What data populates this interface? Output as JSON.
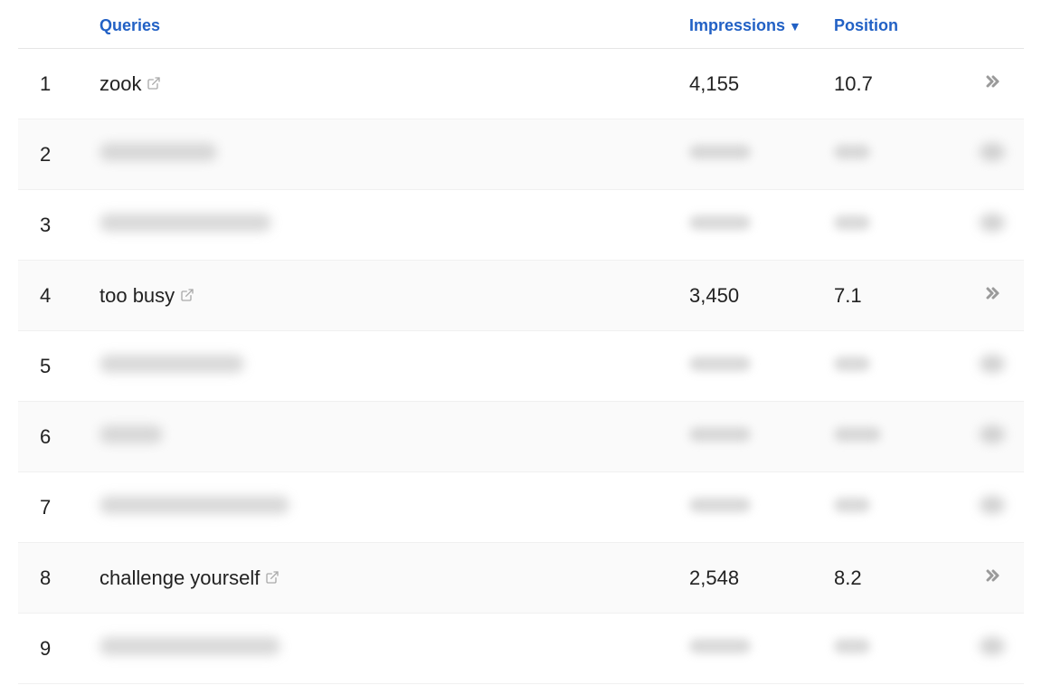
{
  "headers": {
    "queries": "Queries",
    "impressions": "Impressions",
    "position": "Position",
    "sort_indicator": "▼"
  },
  "rows": [
    {
      "rank": "1",
      "query": "zook",
      "impressions": "4,155",
      "position": "10.7",
      "blurred": false
    },
    {
      "rank": "2",
      "query": "",
      "impressions": "",
      "position": "",
      "blurred": true,
      "qwidth": 130,
      "iwidth": 68,
      "pwidth": 40
    },
    {
      "rank": "3",
      "query": "",
      "impressions": "",
      "position": "",
      "blurred": true,
      "qwidth": 190,
      "iwidth": 68,
      "pwidth": 40
    },
    {
      "rank": "4",
      "query": "too busy",
      "impressions": "3,450",
      "position": "7.1",
      "blurred": false
    },
    {
      "rank": "5",
      "query": "",
      "impressions": "",
      "position": "",
      "blurred": true,
      "qwidth": 160,
      "iwidth": 68,
      "pwidth": 40
    },
    {
      "rank": "6",
      "query": "",
      "impressions": "",
      "position": "",
      "blurred": true,
      "qwidth": 70,
      "iwidth": 68,
      "pwidth": 52
    },
    {
      "rank": "7",
      "query": "",
      "impressions": "",
      "position": "",
      "blurred": true,
      "qwidth": 210,
      "iwidth": 68,
      "pwidth": 40
    },
    {
      "rank": "8",
      "query": "challenge yourself",
      "impressions": "2,548",
      "position": "8.2",
      "blurred": false
    },
    {
      "rank": "9",
      "query": "",
      "impressions": "",
      "position": "",
      "blurred": true,
      "qwidth": 200,
      "iwidth": 68,
      "pwidth": 40
    }
  ]
}
